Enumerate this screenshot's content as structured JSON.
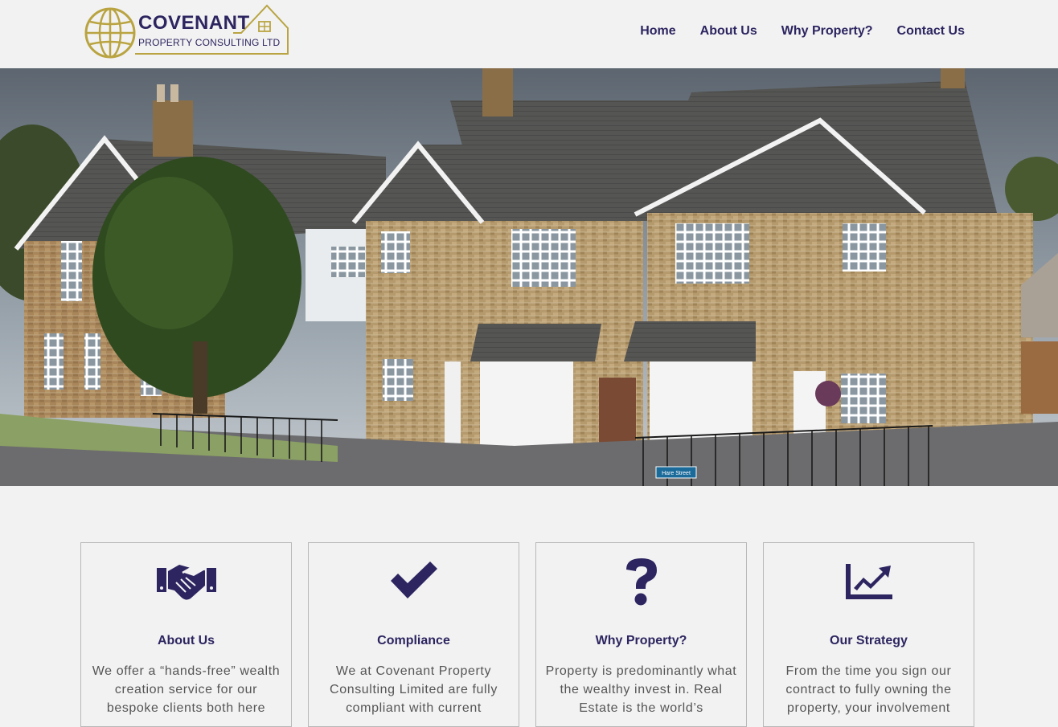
{
  "header": {
    "logo": {
      "name": "COVENANT",
      "subtitle": "PROPERTY CONSULTING LTD"
    },
    "nav": [
      {
        "label": "Home"
      },
      {
        "label": "About Us"
      },
      {
        "label": "Why Property?"
      },
      {
        "label": "Contact Us"
      }
    ]
  },
  "hero": {
    "street_sign": "Hare Street"
  },
  "cards": [
    {
      "icon": "handshake-icon",
      "title": "About Us",
      "text": "We offer a “hands-free” wealth creation service for our bespoke clients both here"
    },
    {
      "icon": "checkmark-icon",
      "title": "Compliance",
      "text": "We at Covenant Property Consulting Limited are  fully compliant with current"
    },
    {
      "icon": "question-mark-icon",
      "title": "Why Property?",
      "text": "Property is predominantly what the wealthy invest in. Real Estate is the world’s"
    },
    {
      "icon": "chart-area-icon",
      "title": "Our Strategy",
      "text": "From the time you sign our contract to fully owning the property, your involvement"
    }
  ],
  "colors": {
    "brand": "#2c2560",
    "gold": "#b9a441",
    "background": "#f2f2f2",
    "body_text": "#555555"
  }
}
